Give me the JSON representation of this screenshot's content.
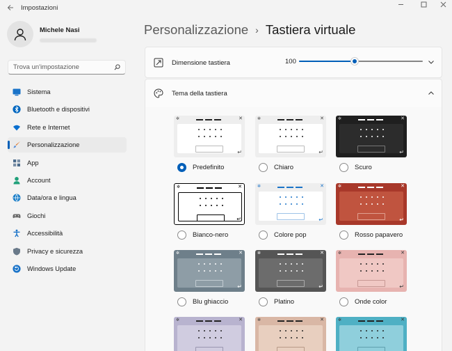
{
  "window": {
    "title": "Impostazioni"
  },
  "profile": {
    "name": "Michele Nasi"
  },
  "search": {
    "placeholder": "Trova un'impostazione"
  },
  "sidebar": {
    "items": [
      {
        "label": "Sistema",
        "icon": "system-icon",
        "color": "#1a73c8"
      },
      {
        "label": "Bluetooth e dispositivi",
        "icon": "bluetooth-icon",
        "color": "#0067c0"
      },
      {
        "label": "Rete e Internet",
        "icon": "wifi-icon",
        "color": "#0a6fcf"
      },
      {
        "label": "Personalizzazione",
        "icon": "brush-icon",
        "color": "#e0792a",
        "active": true
      },
      {
        "label": "App",
        "icon": "apps-icon",
        "color": "#4c6c8c"
      },
      {
        "label": "Account",
        "icon": "account-icon",
        "color": "#20a07a"
      },
      {
        "label": "Data/ora e lingua",
        "icon": "globe-time-icon",
        "color": "#1d7fc8"
      },
      {
        "label": "Giochi",
        "icon": "gamepad-icon",
        "color": "#6a6a6a"
      },
      {
        "label": "Accessibilità",
        "icon": "accessibility-icon",
        "color": "#1a73c8"
      },
      {
        "label": "Privacy e sicurezza",
        "icon": "shield-icon",
        "color": "#6a7a8a"
      },
      {
        "label": "Windows Update",
        "icon": "update-icon",
        "color": "#1a73c8"
      }
    ]
  },
  "breadcrumb": {
    "parent": "Personalizzazione",
    "separator": "›",
    "current": "Tastiera virtuale"
  },
  "keyboard_size": {
    "label": "Dimensione tastiera",
    "value": "100",
    "slider_fraction": 0.45
  },
  "keyboard_theme": {
    "label": "Tema della tastiera",
    "themes": [
      {
        "label": "Predefinito",
        "selected": true,
        "frame": "#eeeeee",
        "body": "#ffffff",
        "dot": "#222222",
        "bar": "#222222",
        "glyph": "#444444",
        "space": "#bbbbbb"
      },
      {
        "label": "Chiaro",
        "selected": false,
        "frame": "#eeeeee",
        "body": "#ffffff",
        "dot": "#222222",
        "bar": "#222222",
        "glyph": "#444444",
        "space": "#bbbbbb"
      },
      {
        "label": "Scuro",
        "selected": false,
        "frame": "#1f1f1f",
        "body": "#2c2c2c",
        "dot": "#ffffff",
        "bar": "#ffffff",
        "glyph": "#dddddd",
        "space": "#777777"
      },
      {
        "label": "Bianco-nero",
        "selected": false,
        "frame": "#ffffff",
        "body": "#ffffff",
        "dot": "#000000",
        "bar": "#000000",
        "glyph": "#000000",
        "space": "#000000",
        "outline": "#000000"
      },
      {
        "label": "Colore pop",
        "selected": false,
        "frame": "#eeeeee",
        "body": "#ffffff",
        "dot": "#1a73c8",
        "bar": "#1a73c8",
        "glyph": "#1a73c8",
        "space": "#9ec3e8"
      },
      {
        "label": "Rosso papavero",
        "selected": false,
        "frame": "#a8382a",
        "body": "#c0543f",
        "dot": "#ffffff",
        "bar": "#ffffff",
        "glyph": "#ffffff",
        "space": "#e0a090"
      },
      {
        "label": "Blu ghiaccio",
        "selected": false,
        "frame": "#6e7f8a",
        "body": "#8e9da6",
        "dot": "#ffffff",
        "bar": "#ffffff",
        "glyph": "#ffffff",
        "space": "#c2ccd2"
      },
      {
        "label": "Platino",
        "selected": false,
        "frame": "#555555",
        "body": "#6c6c6c",
        "dot": "#ffffff",
        "bar": "#ffffff",
        "glyph": "#ffffff",
        "space": "#aaaaaa"
      },
      {
        "label": "Onde color",
        "selected": false,
        "frame": "#e7b3b0",
        "body": "#f0c8c4",
        "dot": "#222222",
        "bar": "#222222",
        "glyph": "#333333",
        "space": "#c79894"
      },
      {
        "label": "",
        "selected": false,
        "frame": "#b8b3cf",
        "body": "#d0cce0",
        "dot": "#222222",
        "bar": "#222222",
        "glyph": "#333333",
        "space": "#9a96b0"
      },
      {
        "label": "",
        "selected": false,
        "frame": "#d9b7a5",
        "body": "#e8cfbf",
        "dot": "#222222",
        "bar": "#222222",
        "glyph": "#333333",
        "space": "#b89a88"
      },
      {
        "label": "",
        "selected": false,
        "frame": "#4fb0c4",
        "body": "#8fcfdc",
        "dot": "#222222",
        "bar": "#222222",
        "glyph": "#333333",
        "space": "#5f9fae"
      }
    ]
  },
  "colors": {
    "accent": "#005fb8"
  }
}
